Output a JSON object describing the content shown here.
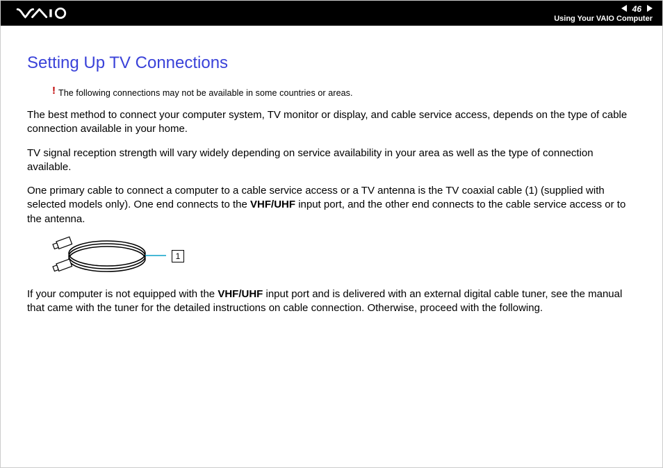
{
  "header": {
    "page_number": "46",
    "section": "Using Your VAIO Computer"
  },
  "title": "Setting Up TV Connections",
  "warning": {
    "mark": "!",
    "text": "The following connections may not be available in some countries or areas."
  },
  "paragraphs": {
    "p1": "The best method to connect your computer system, TV monitor or display, and cable service access, depends on the type of cable connection available in your home.",
    "p2": "TV signal reception strength will vary widely depending on service availability in your area as well as the type of connection available.",
    "p3a": "One primary cable to connect a computer to a cable service access or a TV antenna is the TV coaxial cable (1) (supplied with selected models only). One end connects to the ",
    "p3_bold": "VHF/UHF",
    "p3b": " input port, and the other end connects to the cable service access or to the antenna.",
    "p4a": "If your computer is not equipped with the ",
    "p4_bold": "VHF/UHF",
    "p4b": " input port and is delivered with an external digital cable tuner, see the manual that came with the tuner for the detailed instructions on cable connection. Otherwise, proceed with the following."
  },
  "figure": {
    "callout": "1"
  }
}
